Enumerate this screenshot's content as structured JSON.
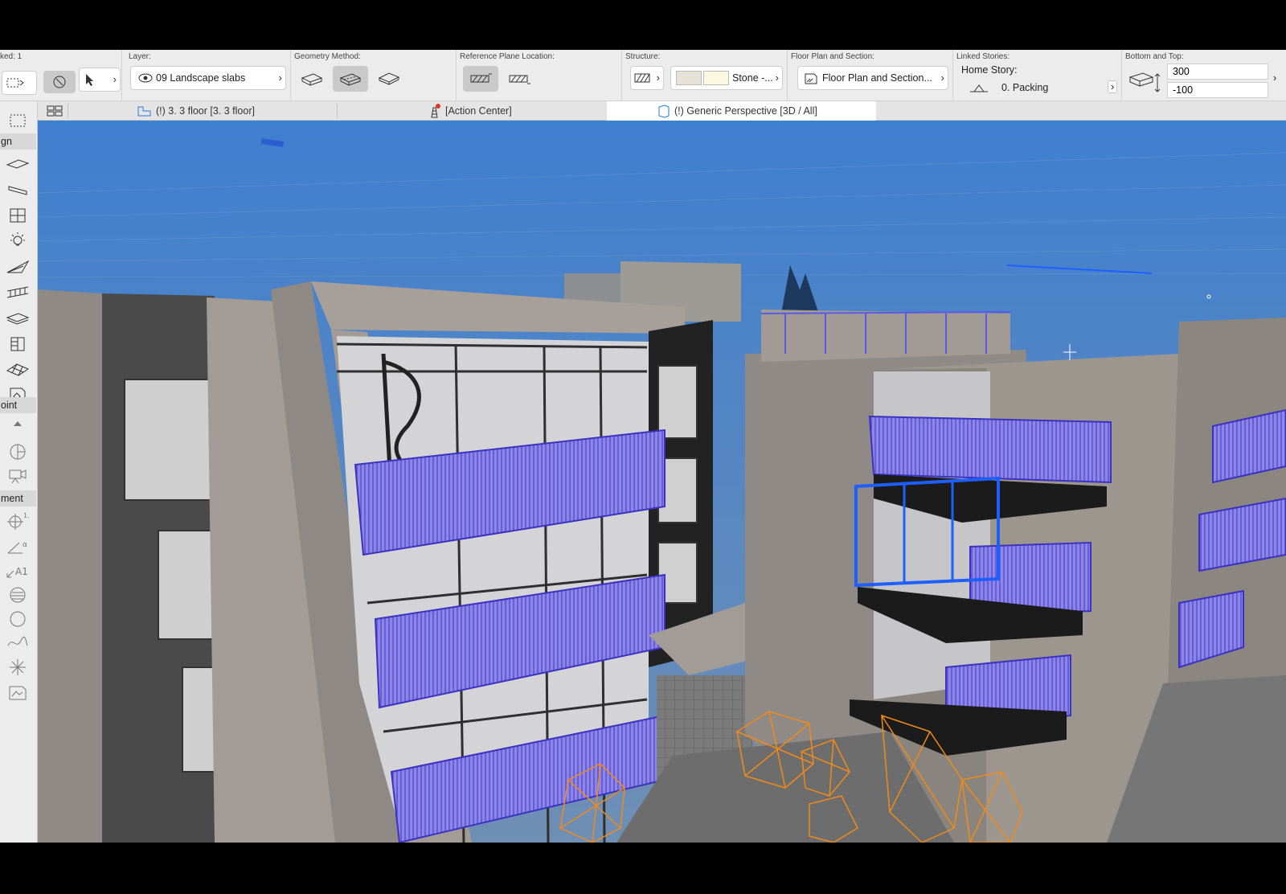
{
  "infobox": {
    "selected_label": "ked: 1",
    "layer": {
      "label": "Layer:",
      "value": "09 Landscape slabs"
    },
    "geometry": {
      "label": "Geometry Method:"
    },
    "ref_plane": {
      "label": "Reference Plane Location:"
    },
    "structure": {
      "label": "Structure:",
      "value": "Stone -..."
    },
    "floor_plan": {
      "label": "Floor Plan and Section:",
      "value": "Floor Plan and Section..."
    },
    "linked": {
      "label": "Linked Stories:",
      "home_label": "Home Story:",
      "home_value": "0. Packing"
    },
    "bottom_top": {
      "label": "Bottom and Top:",
      "top": "300",
      "bottom": "-100"
    }
  },
  "tabs": [
    {
      "label": "(!) 3. 3 floor  [3. 3 floor]",
      "icon": "floor-plan-icon"
    },
    {
      "label": "[Action Center]",
      "icon": "lighthouse-icon"
    },
    {
      "label": "(!) Generic Perspective [3D / All]",
      "icon": "3d-window-icon"
    }
  ],
  "toolbox": {
    "headers": [
      "gn",
      "oint",
      "ment"
    ]
  },
  "colors": {
    "sky": "#4f86c9",
    "concrete": "#a39c96",
    "railing": "#6b63d8",
    "selection": "#1f5fff",
    "trees_wire": "#f08a1a"
  }
}
